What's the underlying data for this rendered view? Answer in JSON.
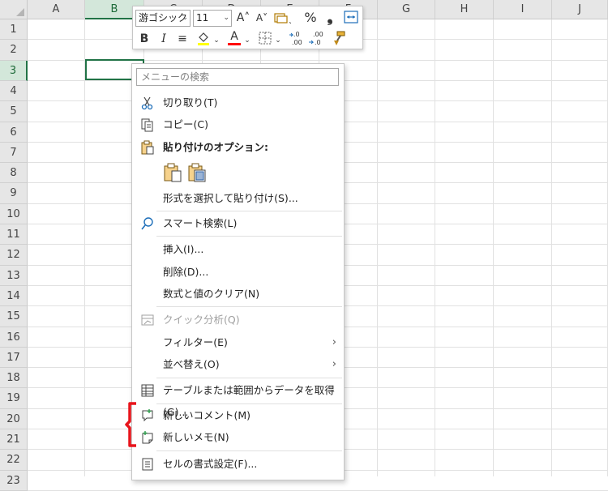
{
  "columns": [
    "A",
    "B",
    "C",
    "D",
    "E",
    "F",
    "G",
    "H",
    "I",
    "J"
  ],
  "rows": [
    "1",
    "2",
    "3",
    "4",
    "5",
    "6",
    "7",
    "8",
    "9",
    "10",
    "11",
    "12",
    "13",
    "14",
    "15",
    "16",
    "17",
    "18",
    "19",
    "20",
    "21",
    "22",
    "23"
  ],
  "mini_toolbar": {
    "font_name": "游ゴシック",
    "font_size": "11",
    "grow_font": "A˄",
    "shrink_font": "A˅",
    "percent": "%",
    "comma": "❟",
    "bold": "B",
    "italic": "I",
    "align": "≡",
    "font_color_letter": "A",
    "dec_inc": ".00",
    "dec_dec": ".00"
  },
  "context_menu": {
    "search_placeholder": "メニューの検索",
    "items": {
      "cut": "切り取り(T)",
      "copy": "コピー(C)",
      "paste_options": "貼り付けのオプション:",
      "paste_special": "形式を選択して貼り付け(S)...",
      "smart_lookup": "スマート検索(L)",
      "insert": "挿入(I)...",
      "delete": "削除(D)...",
      "clear": "数式と値のクリア(N)",
      "quick_analysis": "クイック分析(Q)",
      "filter": "フィルター(E)",
      "sort": "並べ替え(O)",
      "get_data": "テーブルまたは範囲からデータを取得(G)...",
      "new_comment": "新しいコメント(M)",
      "new_note": "新しいメモ(N)",
      "format_cells": "セルの書式設定(F)..."
    },
    "submenu_arrow": "›"
  },
  "colors": {
    "selection_green": "#217346",
    "highlight_red": "#e8141b",
    "fill_yellow": "#ffff00",
    "font_red": "#ff0000"
  }
}
